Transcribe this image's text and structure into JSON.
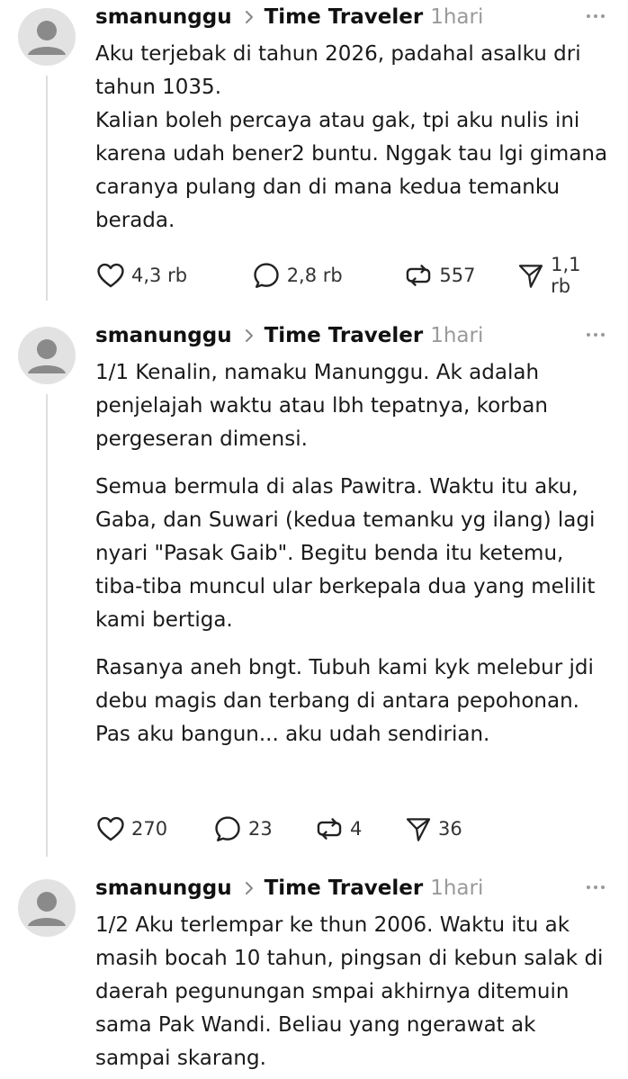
{
  "posts": [
    {
      "username": "smanunggu",
      "topic": "Time Traveler",
      "time": "1hari",
      "paragraphs": [
        "Aku terjebak di tahun 2026, padahal asalku dri tahun 1035.",
        "Kalian boleh percaya atau gak, tpi aku nulis ini karena udah bener2 buntu. Nggak tau lgi gimana caranya pulang dan di mana kedua temanku berada."
      ],
      "likes": "4,3 rb",
      "replies": "2,8 rb",
      "reposts": "557",
      "shares": "1,1 rb"
    },
    {
      "username": "smanunggu",
      "topic": "Time Traveler",
      "time": "1hari",
      "paragraphs": [
        "1/1 Kenalin, namaku Manunggu. Ak adalah penjelajah waktu atau lbh tepatnya, korban pergeseran dimensi.",
        "Semua bermula di alas Pawitra. Waktu itu aku, Gaba, dan Suwari (kedua temanku yg ilang) lagi nyari \"Pasak Gaib\". Begitu benda itu ketemu, tiba-tiba muncul ular berkepala dua yang melilit kami bertiga.",
        "Rasanya aneh bngt. Tubuh kami kyk melebur jdi debu magis dan terbang di antara pepohonan. Pas aku bangun... aku udah sendirian."
      ],
      "likes": "270",
      "replies": "23",
      "reposts": "4",
      "shares": "36"
    },
    {
      "username": "smanunggu",
      "topic": "Time Traveler",
      "time": "1hari",
      "paragraphs": [
        "1/2 Aku terlempar ke thun 2006. Waktu itu ak masih bocah 10 tahun, pingsan di kebun salak di daerah pegunungan smpai akhirnya ditemuin sama Pak Wandi. Beliau yang ngerawat ak sampai skarang."
      ]
    }
  ]
}
